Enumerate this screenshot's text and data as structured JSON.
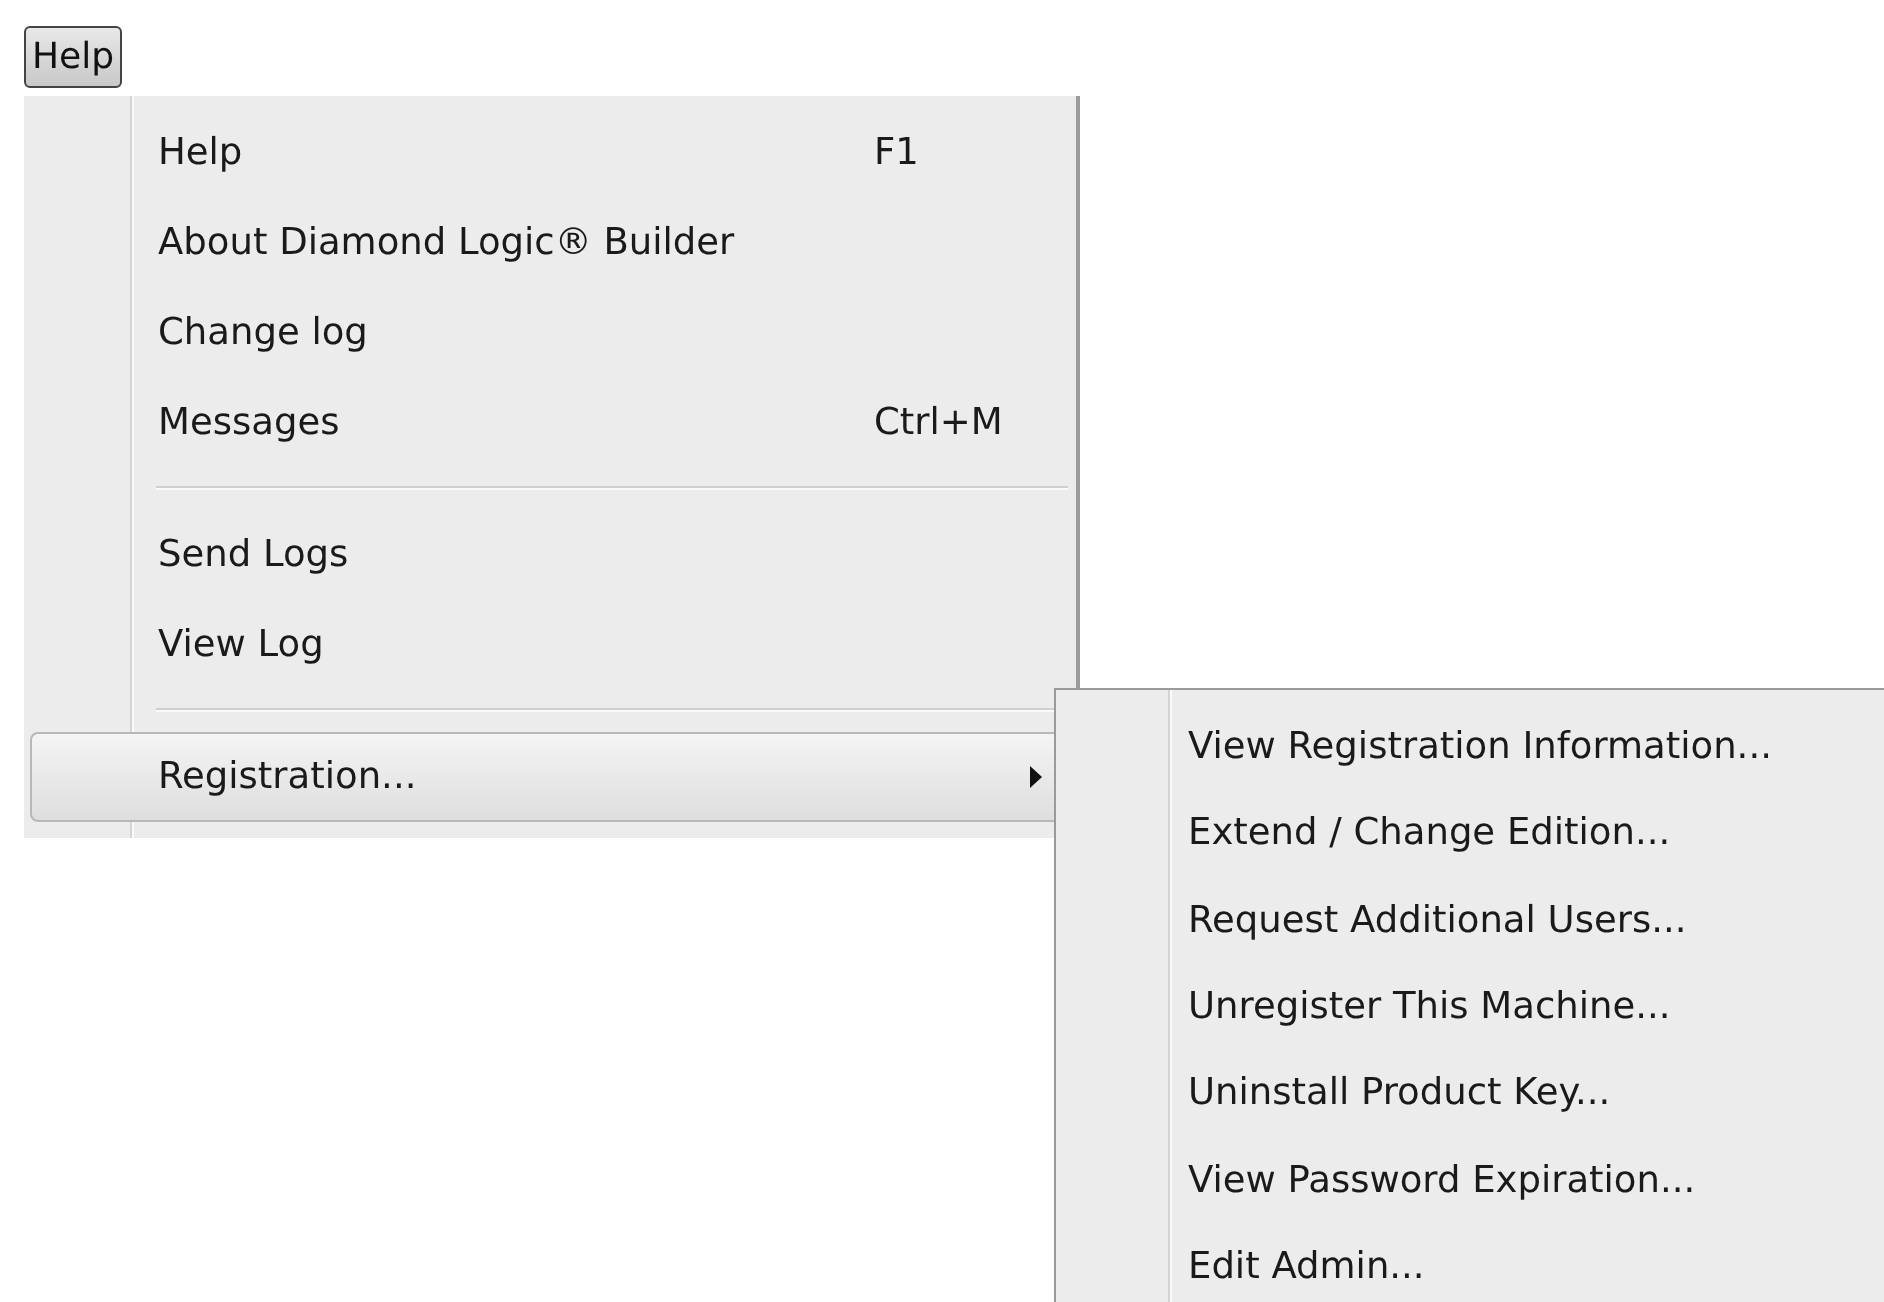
{
  "menu_bar": [
    {
      "label": "Help",
      "selected": true
    }
  ],
  "menu": {
    "groups": [
      [
        {
          "label": "Help",
          "shortcut": "F1",
          "has_submenu": false,
          "selected": false
        },
        {
          "label": "About Diamond Logic® Builder",
          "has_submenu": false,
          "selected": false
        },
        {
          "label": "Change log",
          "has_submenu": false,
          "selected": false
        },
        {
          "label": "Messages",
          "shortcut": "Ctrl+M",
          "has_submenu": false,
          "selected": false
        }
      ],
      [
        {
          "label": "Send Logs",
          "has_submenu": false,
          "selected": false
        },
        {
          "label": "View Log",
          "has_submenu": false,
          "selected": false
        }
      ],
      [
        {
          "label": "Registration...",
          "has_submenu": true,
          "selected": true
        }
      ]
    ]
  },
  "submenu": {
    "items": [
      {
        "label": "View Registration Information..."
      },
      {
        "label": "Extend / Change Edition..."
      },
      {
        "label": "Request Additional Users..."
      },
      {
        "label": "Unregister This Machine..."
      },
      {
        "label": "Uninstall Product Key..."
      },
      {
        "label": "View Password Expiration..."
      },
      {
        "label": "Edit Admin..."
      }
    ]
  }
}
